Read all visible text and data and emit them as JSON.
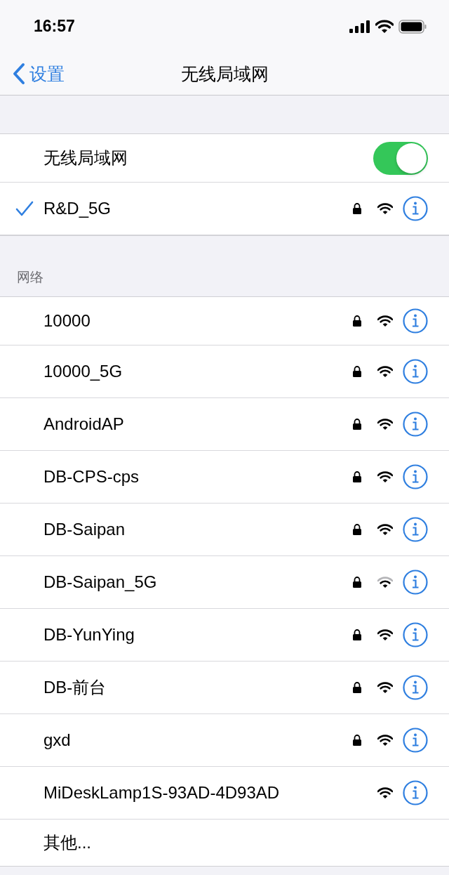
{
  "status_bar": {
    "time": "16:57"
  },
  "nav": {
    "back": "设置",
    "title": "无线局域网"
  },
  "wifi_toggle": {
    "label": "无线局域网",
    "on": true
  },
  "connected": {
    "name": "R&D_5G",
    "checked": true,
    "locked": true,
    "weak_signal": false
  },
  "section": {
    "header": "网络"
  },
  "networks": [
    {
      "name": "10000",
      "locked": true,
      "weak_signal": false
    },
    {
      "name": "10000_5G",
      "locked": true,
      "weak_signal": false
    },
    {
      "name": "AndroidAP",
      "locked": true,
      "weak_signal": false
    },
    {
      "name": "DB-CPS-cps",
      "locked": true,
      "weak_signal": false
    },
    {
      "name": "DB-Saipan",
      "locked": true,
      "weak_signal": false
    },
    {
      "name": "DB-Saipan_5G",
      "locked": true,
      "weak_signal": true
    },
    {
      "name": "DB-YunYing",
      "locked": true,
      "weak_signal": false
    },
    {
      "name": "DB-前台",
      "locked": true,
      "weak_signal": false
    },
    {
      "name": "gxd",
      "locked": true,
      "weak_signal": false
    },
    {
      "name": "MiDeskLamp1S-93AD-4D93AD",
      "locked": false,
      "weak_signal": false
    }
  ],
  "other": {
    "label": "其他..."
  }
}
